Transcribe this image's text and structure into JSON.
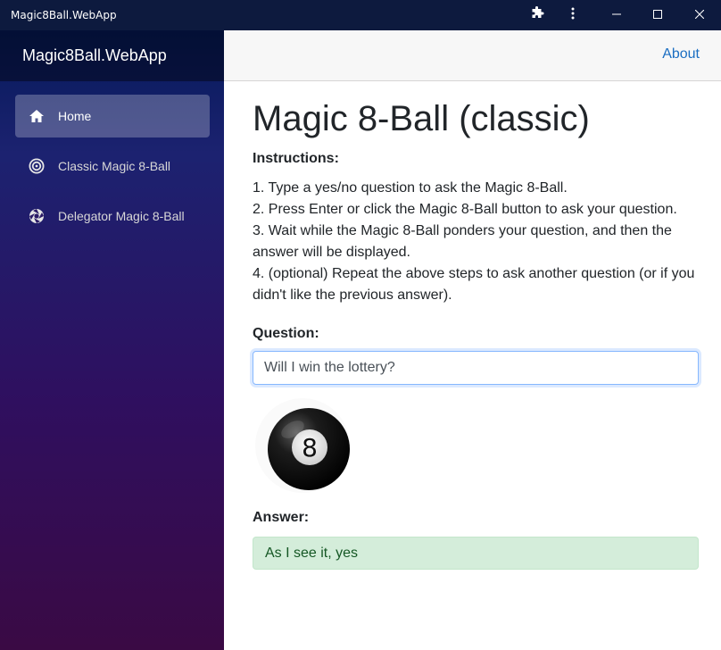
{
  "window": {
    "title": "Magic8Ball.WebApp"
  },
  "sidebar": {
    "brand": "Magic8Ball.WebApp",
    "items": [
      {
        "label": "Home",
        "icon": "home-icon",
        "active": true
      },
      {
        "label": "Classic Magic 8-Ball",
        "icon": "target-icon",
        "active": false
      },
      {
        "label": "Delegator Magic 8-Ball",
        "icon": "aperture-icon",
        "active": false
      }
    ]
  },
  "top_row": {
    "about_label": "About"
  },
  "main": {
    "title": "Magic 8-Ball (classic)",
    "instructions_label": "Instructions:",
    "steps": [
      "1. Type a yes/no question to ask the Magic 8-Ball.",
      "2. Press Enter or click the Magic 8-Ball button to ask your question.",
      "3. Wait while the Magic 8-Ball ponders your question, and then the answer will be displayed.",
      "4. (optional) Repeat the above steps to ask another question (or if you didn't like the previous answer)."
    ],
    "question_label": "Question:",
    "question_value": "Will I win the lottery?",
    "ball_number": "8",
    "answer_label": "Answer:",
    "answer_text": "As I see it, yes"
  },
  "colors": {
    "link": "#1b6ec2",
    "answer_bg": "#d4edda",
    "answer_text": "#155724",
    "titlebar": "#0d1a3e"
  }
}
